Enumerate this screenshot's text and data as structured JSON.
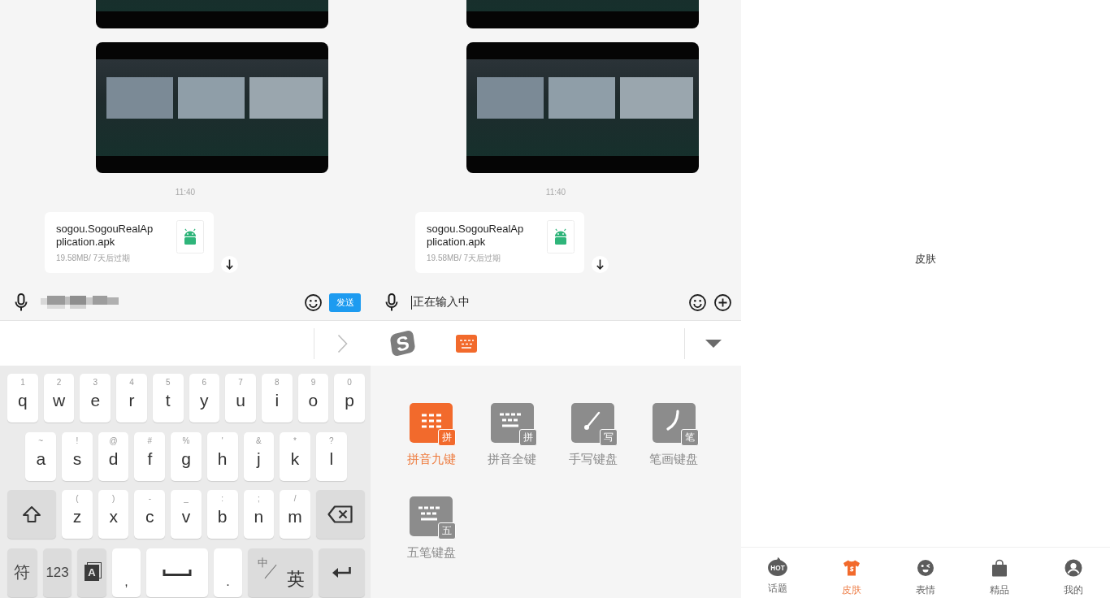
{
  "screens": [
    {
      "kind": "chat",
      "messages": [
        {
          "kind": "image"
        },
        {
          "kind": "image"
        },
        {
          "kind": "time",
          "text": "11:40"
        },
        {
          "kind": "file",
          "name": "sogou.SogouRealApplication.apk",
          "meta": "19.58MB/ 7天后过期"
        }
      ],
      "input": {
        "blurred": true,
        "focused": false,
        "actions": [
          {
            "kind": "emoji"
          },
          {
            "kind": "send",
            "label": "发送"
          }
        ]
      },
      "ime_bar": {
        "kind": "candidates"
      },
      "panel": {
        "kind": "keyboard",
        "rows": [
          [
            {
              "kind": "letter",
              "hint": "1",
              "label": "q"
            },
            {
              "kind": "letter",
              "hint": "2",
              "label": "w"
            },
            {
              "kind": "letter",
              "hint": "3",
              "label": "e"
            },
            {
              "kind": "letter",
              "hint": "4",
              "label": "r"
            },
            {
              "kind": "letter",
              "hint": "5",
              "label": "t"
            },
            {
              "kind": "letter",
              "hint": "6",
              "label": "y"
            },
            {
              "kind": "letter",
              "hint": "7",
              "label": "u"
            },
            {
              "kind": "letter",
              "hint": "8",
              "label": "i"
            },
            {
              "kind": "letter",
              "hint": "9",
              "label": "o"
            },
            {
              "kind": "letter",
              "hint": "0",
              "label": "p"
            }
          ],
          [
            {
              "kind": "letter",
              "hint": "~",
              "label": "a"
            },
            {
              "kind": "letter",
              "hint": "!",
              "label": "s"
            },
            {
              "kind": "letter",
              "hint": "@",
              "label": "d"
            },
            {
              "kind": "letter",
              "hint": "#",
              "label": "f"
            },
            {
              "kind": "letter",
              "hint": "%",
              "label": "g"
            },
            {
              "kind": "letter",
              "hint": "'",
              "label": "h"
            },
            {
              "kind": "letter",
              "hint": "&",
              "label": "j"
            },
            {
              "kind": "letter",
              "hint": "*",
              "label": "k"
            },
            {
              "kind": "letter",
              "hint": "?",
              "label": "l"
            }
          ],
          [
            {
              "kind": "shift"
            },
            {
              "kind": "letter",
              "hint": "(",
              "label": "z"
            },
            {
              "kind": "letter",
              "hint": ")",
              "label": "x"
            },
            {
              "kind": "letter",
              "hint": "-",
              "label": "c"
            },
            {
              "kind": "letter",
              "hint": "_",
              "label": "v"
            },
            {
              "kind": "letter",
              "hint": ":",
              "label": "b"
            },
            {
              "kind": "letter",
              "hint": ";",
              "label": "n"
            },
            {
              "kind": "letter",
              "hint": "/",
              "label": "m"
            },
            {
              "kind": "backspace"
            }
          ],
          [
            {
              "kind": "symbols",
              "label": "符"
            },
            {
              "kind": "numbers",
              "label": "123"
            },
            {
              "kind": "mode",
              "label": "A"
            },
            {
              "kind": "punct",
              "label": ","
            },
            {
              "kind": "space"
            },
            {
              "kind": "punct",
              "label": "."
            },
            {
              "kind": "lang",
              "top": "中",
              "bottom": "英"
            },
            {
              "kind": "enter"
            }
          ]
        ]
      }
    },
    {
      "kind": "chat",
      "messages": [
        {
          "kind": "image"
        },
        {
          "kind": "image"
        },
        {
          "kind": "time",
          "text": "11:40"
        },
        {
          "kind": "file",
          "name": "sogou.SogouRealApplication.apk",
          "meta": "19.58MB/ 7天后过期"
        }
      ],
      "input": {
        "value": "正在输入中",
        "blurred": false,
        "focused": true,
        "actions": [
          {
            "kind": "emoji"
          },
          {
            "kind": "add"
          }
        ]
      },
      "ime_bar": {
        "kind": "toolbar",
        "logo": "S"
      },
      "panel": {
        "kind": "layouts",
        "options": [
          {
            "kind": "nine",
            "badge": "拼",
            "label": "拼音九键",
            "selected": true
          },
          {
            "kind": "full",
            "badge": "拼",
            "label": "拼音全键",
            "selected": false
          },
          {
            "kind": "handwriting",
            "badge": "写",
            "label": "手写键盘",
            "selected": false
          },
          {
            "kind": "stroke",
            "badge": "笔",
            "label": "笔画键盘",
            "selected": false
          },
          {
            "kind": "full",
            "badge": "五",
            "label": "五笔键盘",
            "selected": false
          }
        ]
      }
    },
    {
      "kind": "page",
      "title": "皮肤",
      "nav": [
        {
          "kind": "hot",
          "icon_text": "HOT",
          "label": "话题",
          "selected": false
        },
        {
          "kind": "shirt",
          "label": "皮肤",
          "selected": true
        },
        {
          "kind": "face",
          "label": "表情",
          "selected": false
        },
        {
          "kind": "bag",
          "label": "精品",
          "selected": false
        },
        {
          "kind": "user",
          "label": "我的",
          "selected": false
        }
      ]
    }
  ]
}
